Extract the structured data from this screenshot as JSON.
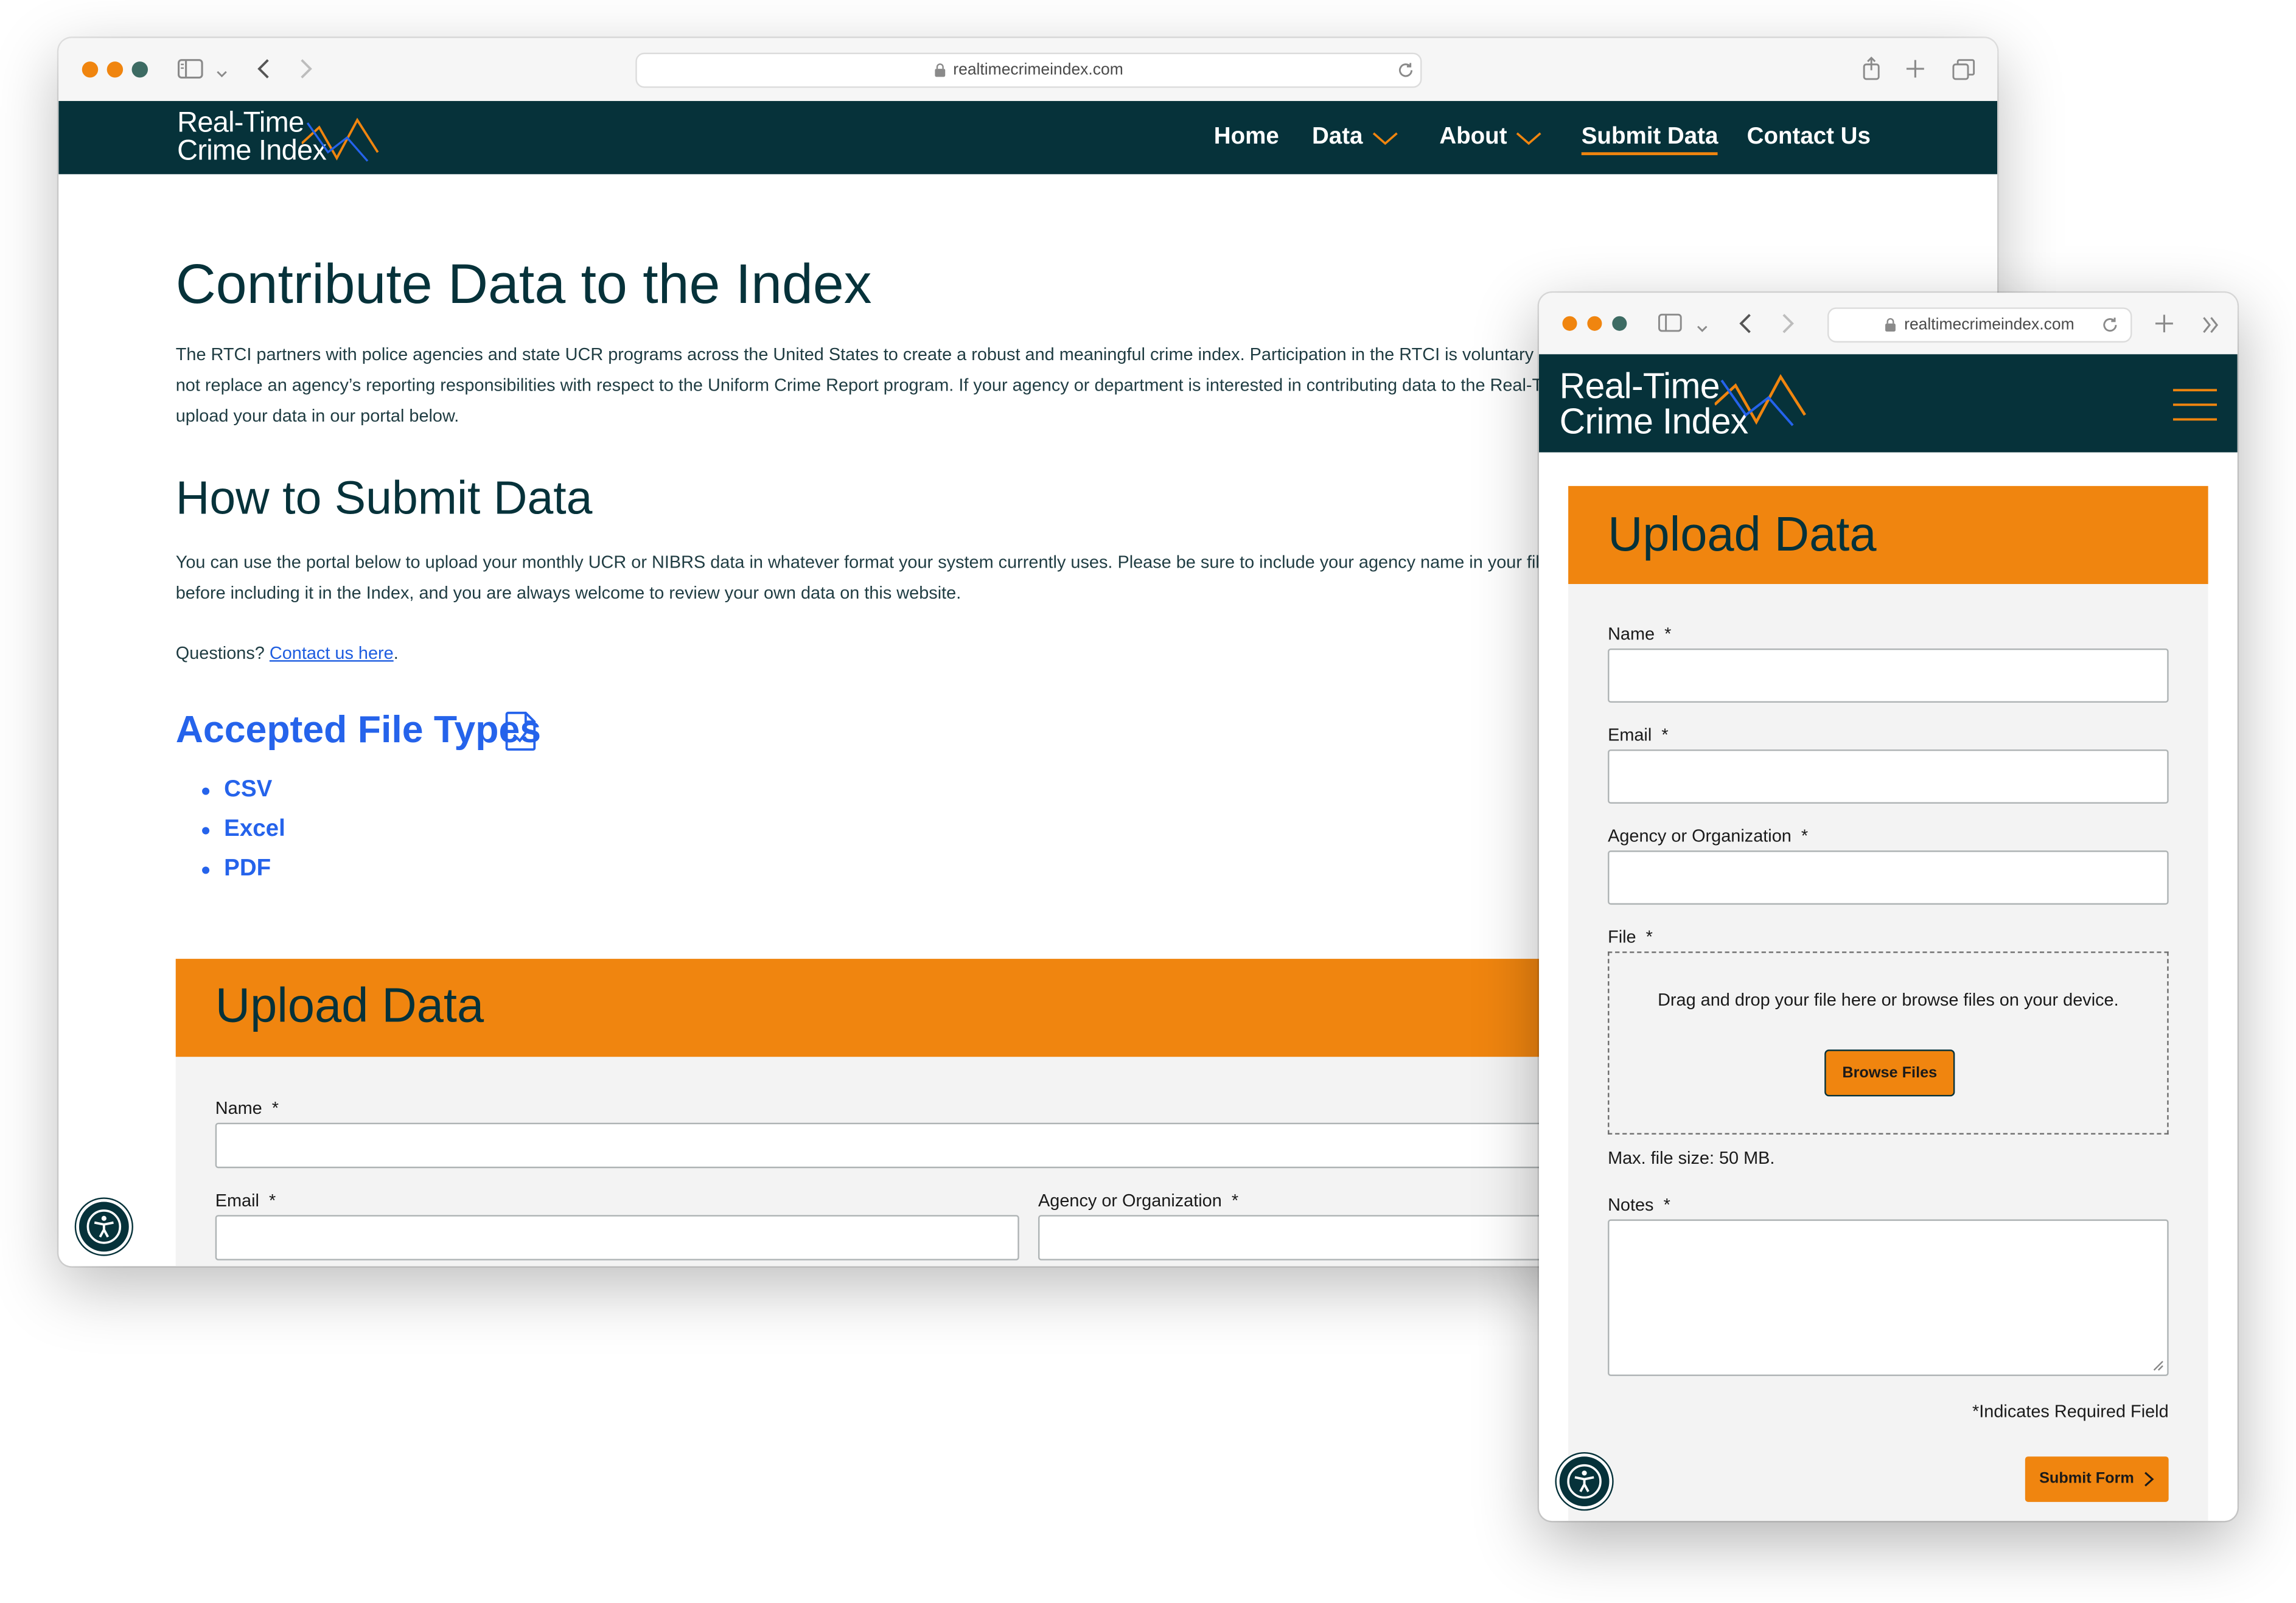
{
  "site": {
    "url": "realtimecrimeindex.com",
    "logo_line1": "Real-Time",
    "logo_line2": "Crime Index"
  },
  "nav": {
    "home": "Home",
    "data": "Data",
    "about": "About",
    "submit": "Submit Data",
    "contact": "Contact Us"
  },
  "main": {
    "title": "Contribute Data to the Index",
    "intro_line1": "The RTCI partners with police agencies and state UCR programs across the United States to create a robust and meaningful crime index. Participation in the RTCI is voluntary and",
    "intro_line2": "not replace an agency’s reporting responsibilities with respect to the Uniform Crime Report program. If your agency or department is interested in contributing data to the Real-Tim",
    "intro_line3": "upload your data in our portal below.",
    "how_title": "How to Submit Data",
    "how_line1": "You can use the portal below to upload your monthly UCR or NIBRS data in whatever format your system currently uses. Please be sure to include your agency name in your file. Th",
    "how_line2": "before including it in the Index, and you are always welcome to review your own data on this website.",
    "questions_prefix": "Questions?",
    "contact_link": "Contact us here",
    "questions_suffix": ".",
    "file_types_title": "Accepted File Types",
    "file_types": [
      "CSV",
      "Excel",
      "PDF"
    ]
  },
  "form": {
    "title": "Upload Data",
    "name_label": "Name",
    "email_label": "Email",
    "agency_label": "Agency or Organization",
    "file_label": "File",
    "notes_label": "Notes",
    "required_mark": "*",
    "dropzone_text": "Drag and drop your file here or browse files on your device.",
    "browse_button": "Browse Files",
    "max_size": "Max. file size: 50 MB.",
    "required_note": "*Indicates Required Field",
    "submit_button": "Submit Form"
  },
  "colors": {
    "navy": "#06323a",
    "orange": "#f0850f",
    "link_blue": "#2563eb",
    "form_bg": "#f3f3f3",
    "traffic_dots": [
      "#f0850f",
      "#f0850f",
      "#3d6b63"
    ]
  },
  "icons": {
    "file_types": "document-check-icon",
    "accessibility": "accessibility-icon",
    "menu": "hamburger-menu-icon"
  }
}
